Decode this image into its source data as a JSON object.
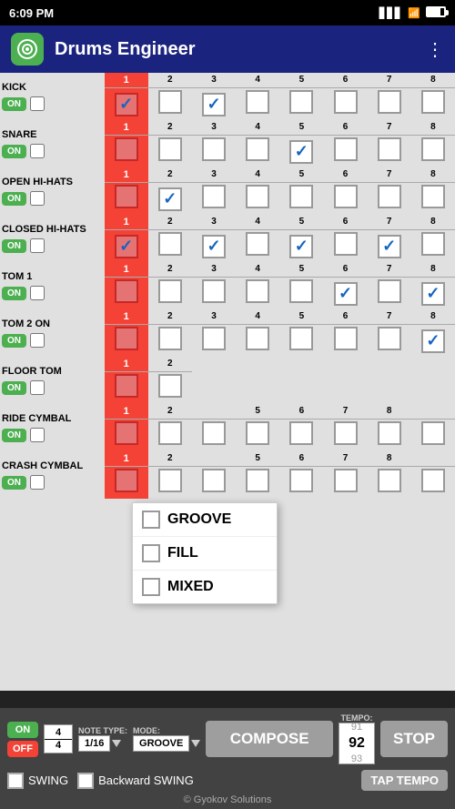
{
  "statusBar": {
    "time": "6:09 PM",
    "batteryLevel": 80
  },
  "header": {
    "title": "Drums Engineer",
    "menuIcon": "⋮"
  },
  "rows": [
    {
      "id": "kick",
      "label": "KICK",
      "beats": [
        true,
        false,
        true,
        false,
        false,
        false,
        false,
        false
      ],
      "activeCol": 1
    },
    {
      "id": "snare",
      "label": "SNARE",
      "beats": [
        false,
        false,
        false,
        false,
        true,
        false,
        false,
        false
      ],
      "activeCol": 1
    },
    {
      "id": "open-hi-hats",
      "label": "OPEN HI-HATS",
      "beats": [
        false,
        true,
        false,
        false,
        false,
        false,
        false,
        false
      ],
      "activeCol": 1
    },
    {
      "id": "closed-hi-hats",
      "label": "CLOSED HI-HATS",
      "beats": [
        true,
        false,
        true,
        false,
        true,
        false,
        true,
        false
      ],
      "activeCol": 1
    },
    {
      "id": "tom1",
      "label": "TOM 1",
      "beats": [
        false,
        false,
        false,
        false,
        false,
        true,
        false,
        true
      ],
      "activeCol": 1
    },
    {
      "id": "tom2",
      "label": "TOM 2",
      "beats": [
        false,
        false,
        false,
        false,
        false,
        false,
        false,
        true
      ],
      "activeCol": 1
    },
    {
      "id": "floor-tom",
      "label": "FLOOR TOM",
      "beats": [
        false,
        false,
        false,
        false,
        false,
        false,
        false,
        false
      ],
      "activeCol": 1
    },
    {
      "id": "ride-cymbal",
      "label": "RIDE CYMBAL",
      "beats": [
        false,
        false,
        false,
        false,
        false,
        false,
        false,
        false
      ],
      "activeCol": 1
    },
    {
      "id": "crash-cymbal",
      "label": "CRASH CYMBAL",
      "beats": [
        false,
        false,
        false,
        false,
        false,
        false,
        false,
        false
      ],
      "activeCol": 1
    }
  ],
  "beatNumbers": [
    1,
    2,
    3,
    4,
    5,
    6,
    7,
    8
  ],
  "dropdown": {
    "items": [
      "GROOVE",
      "FILL",
      "MIXED"
    ],
    "visible": true
  },
  "toolbar": {
    "onLabel": "ON",
    "offLabel": "OFF",
    "fraction": {
      "top": "4",
      "bottom": "4"
    },
    "noteTypeLabel": "NOTE TYPE:",
    "noteTypeValue": "1/16",
    "modeLabel": "MODE:",
    "modeValue": "GROOVE",
    "composeLabel": "COMPOSE",
    "tempoLabel": "TEMPO:",
    "tempoValues": [
      "91",
      "92",
      "93"
    ],
    "stopLabel": "STOP",
    "swingLabel": "SWING",
    "backwardSwingLabel": "Backward SWING",
    "tapTempoLabel": "TAP TEMPO",
    "copyright": "© Gyokov Solutions"
  }
}
